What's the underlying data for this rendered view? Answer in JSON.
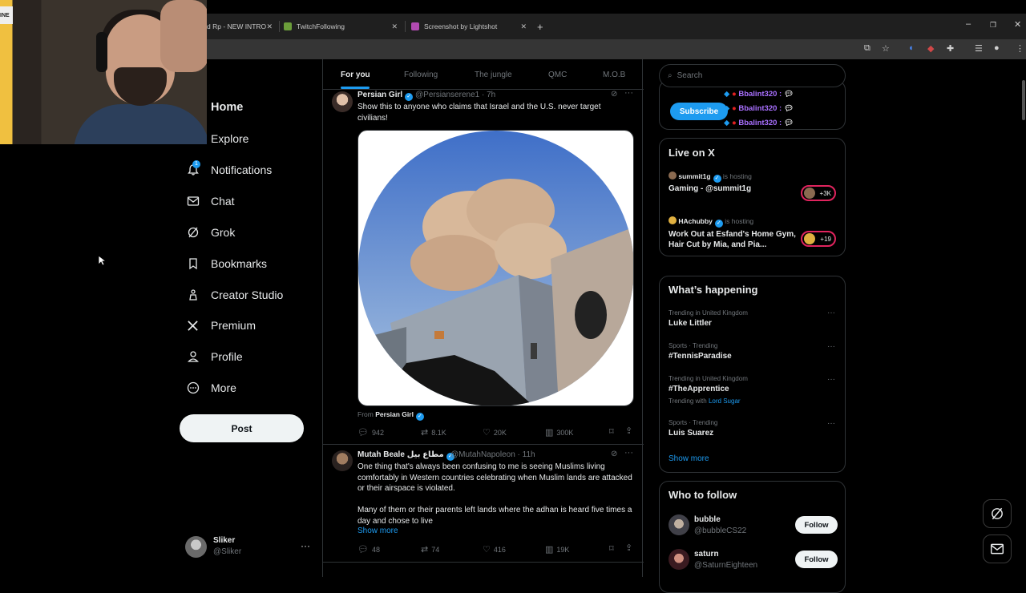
{
  "browser": {
    "tabs": [
      {
        "title": "d Rp - NEW INTRO"
      },
      {
        "title": "TwitchFollowing"
      },
      {
        "title": "Screenshot by Lightshot"
      }
    ],
    "new_tab": "+"
  },
  "nav": {
    "items": [
      {
        "label": "Home",
        "icon": "home-icon"
      },
      {
        "label": "Explore",
        "icon": "search-icon"
      },
      {
        "label": "Notifications",
        "icon": "bell-icon",
        "badge": "1"
      },
      {
        "label": "Chat",
        "icon": "mail-icon"
      },
      {
        "label": "Grok",
        "icon": "grok-icon"
      },
      {
        "label": "Bookmarks",
        "icon": "bookmark-icon"
      },
      {
        "label": "Creator Studio",
        "icon": "creator-icon"
      },
      {
        "label": "Premium",
        "icon": "x-logo-icon"
      },
      {
        "label": "Profile",
        "icon": "person-icon"
      },
      {
        "label": "More",
        "icon": "more-circle-icon"
      }
    ],
    "post_label": "Post",
    "account": {
      "name": "Sliker",
      "handle": "@Sliker"
    }
  },
  "timeline": {
    "tabs": [
      "For you",
      "Following",
      "The jungle",
      "QMC",
      "M.O.B"
    ],
    "tweets": [
      {
        "name": "Persian Girl",
        "handle": "@Persianserene1 · 7h",
        "text": "Show this to anyone who claims that Israel and the U.S. never target civilians!",
        "from_label": "From",
        "from_name": "Persian Girl",
        "replies": "942",
        "reposts": "8.1K",
        "likes": "20K",
        "views": "300K"
      },
      {
        "name": "Mutah Beale مطاع بيل",
        "handle": "@MutahNapoleon · 11h",
        "text1": "One thing that's always been confusing to me is seeing Muslims living comfortably in Western countries celebrating when Muslim lands are attacked or their airspace is violated.",
        "text2": "Many of them or their parents left lands where the adhan is heard five times a day and chose to live",
        "show_more": "Show more",
        "replies": "48",
        "reposts": "74",
        "likes": "416",
        "views": "19K"
      }
    ]
  },
  "right": {
    "search_placeholder": "Search",
    "subscribe": "Subscribe",
    "chat_users": [
      "Bbalint320 :",
      "Bbalint320 :",
      "Bbalint320 :"
    ],
    "live": {
      "title": "Live on X",
      "items": [
        {
          "host": "summit1g",
          "hosting": "is hosting",
          "title": "Gaming - @summit1g",
          "count": "+3K"
        },
        {
          "host": "HAchubby",
          "hosting": "is hosting",
          "title": "Work Out at Esfand's Home Gym, Hair Cut by Mia, and Pia...",
          "count": "+19"
        }
      ]
    },
    "happening": {
      "title": "What’s happening",
      "items": [
        {
          "context": "Trending in United Kingdom",
          "topic": "Luke Littler",
          "extra": ""
        },
        {
          "context": "Sports · Trending",
          "topic": "#TennisParadise",
          "extra": ""
        },
        {
          "context": "Trending in United Kingdom",
          "topic": "#TheApprentice",
          "extra_prefix": "Trending with",
          "extra": "Lord Sugar"
        },
        {
          "context": "Sports · Trending",
          "topic": "Luis Suarez",
          "extra": ""
        }
      ],
      "show_more": "Show more"
    },
    "who_to_follow": {
      "title": "Who to follow",
      "items": [
        {
          "name": "bubble",
          "handle": "@bubbleCS22",
          "button": "Follow"
        },
        {
          "name": "saturn",
          "handle": "@SaturnEighteen",
          "button": "Follow"
        }
      ]
    }
  },
  "colors": {
    "accent": "#1d9bf0",
    "background": "#000000",
    "border": "#2f3336",
    "muted": "#71767b"
  }
}
